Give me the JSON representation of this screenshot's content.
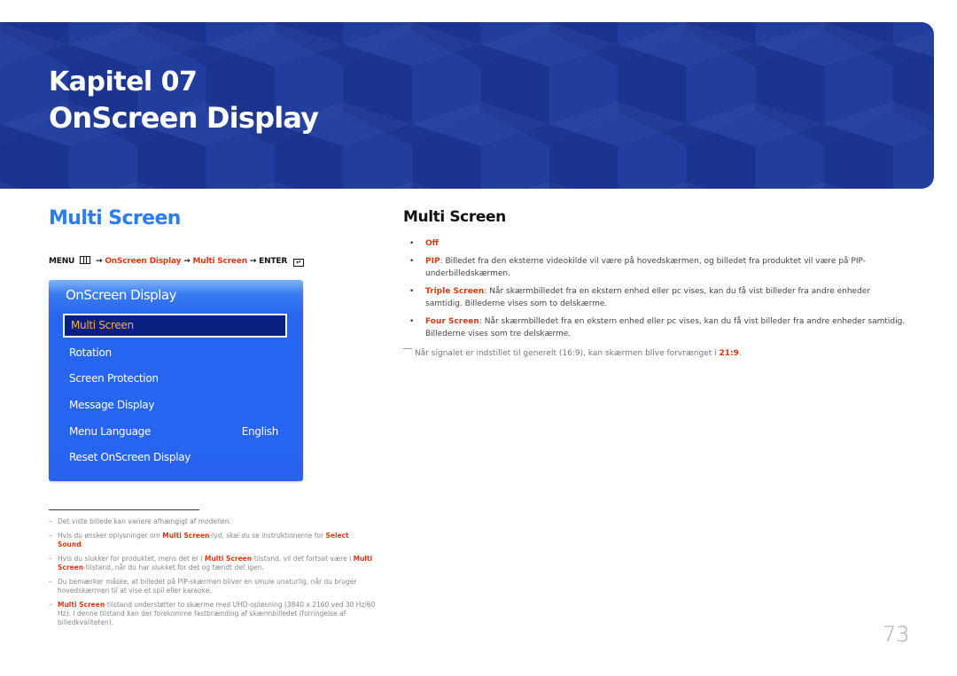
{
  "banner": {
    "chapter": "Kapitel 07",
    "title": "OnScreen Display",
    "background_color": "#1e3a9c"
  },
  "left": {
    "heading": "Multi Screen",
    "menu_path": {
      "menu_label": "MENU",
      "menu_icon": "menu-icon",
      "arrow": "→",
      "step1": "OnScreen Display",
      "step2": "Multi Screen",
      "enter_label": "ENTER",
      "enter_icon": "enter-icon"
    },
    "osd": {
      "title": "OnScreen Display",
      "items": [
        {
          "label": "Multi Screen",
          "value": "",
          "selected": true
        },
        {
          "label": "Rotation",
          "value": ""
        },
        {
          "label": "Screen Protection",
          "value": ""
        },
        {
          "label": "Message Display",
          "value": ""
        },
        {
          "label": "Menu Language",
          "value": "English"
        },
        {
          "label": "Reset OnScreen Display",
          "value": ""
        }
      ]
    }
  },
  "right": {
    "heading": "Multi Screen",
    "bullets": [
      {
        "keyword": "Off",
        "text": ""
      },
      {
        "keyword": "PIP",
        "text": ": Billedet fra den eksterne videokilde vil være på hovedskærmen, og billedet fra produktet vil være på PIP-underbilledskærmen."
      },
      {
        "keyword": "Triple Screen",
        "text": ": Når skærmbilledet fra en ekstern enhed eller pc vises, kan du få vist billeder fra andre enheder samtidig. Billederne vises som to delskærme."
      },
      {
        "keyword": "Four Screen",
        "text": ": Når skærmbilledet fra en ekstern enhed eller pc vises, kan du få vist billeder fra andre enheder samtidig. Billederne vises som tre delskærme."
      }
    ],
    "note": {
      "text": "Når signalet er indstillet til generelt (16:9), kan skærmen blive forvrænget i ",
      "keyword": "21:9",
      "end": "."
    }
  },
  "footnotes": [
    {
      "parts": [
        {
          "t": "Det viste billede kan variere afhængigt af modellen."
        }
      ]
    },
    {
      "parts": [
        {
          "t": "Hvis du ønsker oplysninger om "
        },
        {
          "t": "Multi Screen",
          "kw": true
        },
        {
          "t": "-lyd, skal du se instruktionerne for "
        },
        {
          "t": "Select Sound",
          "kw": true
        },
        {
          "t": "."
        }
      ]
    },
    {
      "parts": [
        {
          "t": "Hvis du slukker for produktet, mens det er i "
        },
        {
          "t": "Multi Screen",
          "kw": true
        },
        {
          "t": "-tilstand, vil det fortsat være i "
        },
        {
          "t": "Multi Screen",
          "kw": true
        },
        {
          "t": "-tilstand, når du har slukket for det og tændt det igen."
        }
      ]
    },
    {
      "parts": [
        {
          "t": "Du bemærker måske, at billedet på PIP-skærmen bliver en smule unaturlig, når du bruger hovedskærmen til at vise et spil eller karaoke."
        }
      ]
    },
    {
      "parts": [
        {
          "t": "Multi Screen",
          "kw": true
        },
        {
          "t": "-tilstand understøtter to skærme med UHD-opløsning (3840 x 2160 ved 30 Hz/60 Hz). I denne tilstand kan der forekomme fastbrænding af skærmbilledet (forringelse af billedkvaliteten)."
        }
      ]
    }
  ],
  "page_number": "73",
  "colors": {
    "accent_red": "#d43a12",
    "heading_blue": "#2b7ef0",
    "osd_blue": "#2763f0",
    "osd_selected_bg": "#0a1f82",
    "osd_selected_text": "#f5b524"
  }
}
